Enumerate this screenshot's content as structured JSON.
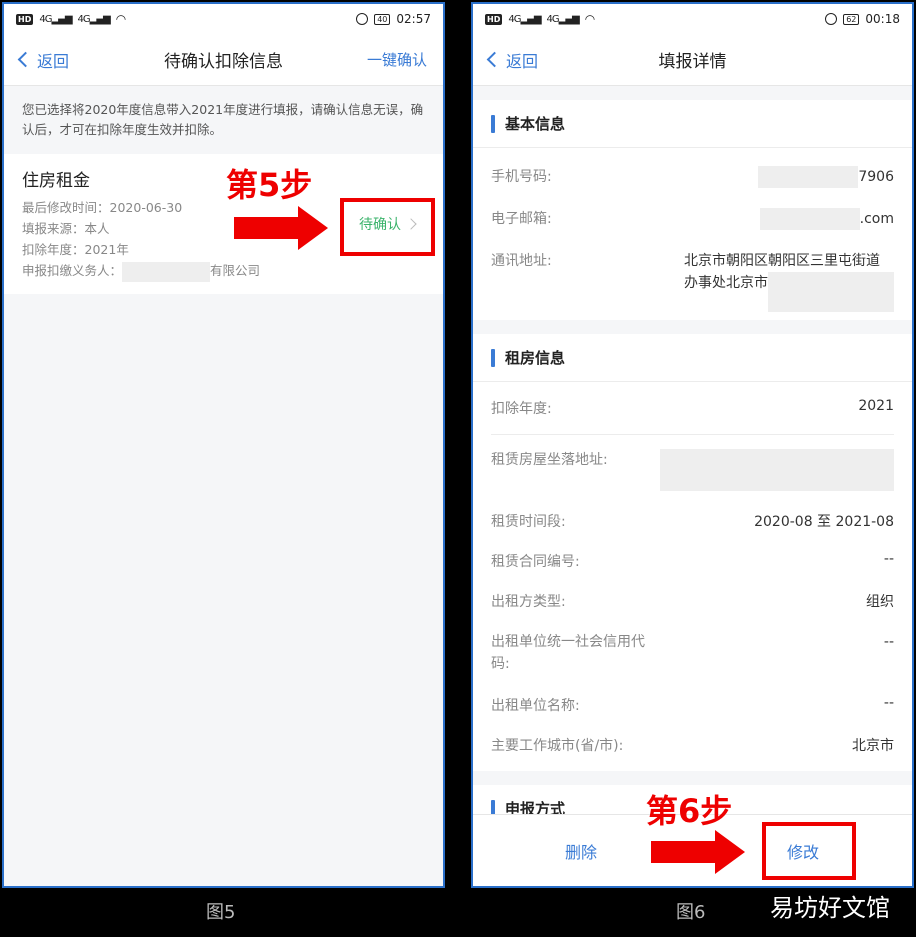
{
  "phone5": {
    "status": {
      "network": "HD",
      "signal1": "4G",
      "signal2": "4G",
      "battery": "40",
      "time": "02:57"
    },
    "nav": {
      "back": "返回",
      "title": "待确认扣除信息",
      "action": "一键确认"
    },
    "notice": "您已选择将2020年度信息带入2021年度进行填报，请确认信息无误，确认后，才可在扣除年度生效并扣除。",
    "card": {
      "title": "住房租金",
      "modified_label": "最后修改时间：",
      "modified_value": "2020-06-30",
      "source_label": "填报来源：",
      "source_value": "本人",
      "year_label": "扣除年度：",
      "year_value": "2021年",
      "agent_label": "申报扣缴义务人：",
      "agent_suffix": "有限公司",
      "status": "待确认"
    },
    "step": "第5步",
    "caption": "图5"
  },
  "phone6": {
    "status": {
      "network": "HD",
      "signal1": "4G",
      "signal2": "4G",
      "battery": "62",
      "time": "00:18"
    },
    "nav": {
      "back": "返回",
      "title": "填报详情"
    },
    "basic": {
      "title": "基本信息",
      "phone_label": "手机号码:",
      "phone_suffix": "7906",
      "email_label": "电子邮箱:",
      "email_suffix": ".com",
      "addr_label": "通讯地址:",
      "addr_line1": "北京市朝阳区朝阳区三里屯街道",
      "addr_line2": "办事处北京市"
    },
    "rent": {
      "title": "租房信息",
      "year_label": "扣除年度:",
      "year_value": "2021",
      "location_label": "租赁房屋坐落地址:",
      "period_label": "租赁时间段:",
      "period_value": "2020-08 至 2021-08",
      "contract_label": "租赁合同编号:",
      "contract_value": "--",
      "lessor_type_label": "出租方类型:",
      "lessor_type_value": "组织",
      "credit_label1": "出租单位统一社会信用代",
      "credit_label2": "码:",
      "credit_value": "--",
      "lessor_name_label": "出租单位名称:",
      "lessor_name_value": "--",
      "city_label": "主要工作城市(省/市):",
      "city_value": "北京市"
    },
    "declare": {
      "title": "申报方式"
    },
    "buttons": {
      "delete": "删除",
      "modify": "修改"
    },
    "step": "第6步",
    "caption": "图6"
  },
  "watermark": "易坊好文馆",
  "colors": {
    "accent": "#3a7bd5",
    "pending": "#3bb36b",
    "highlight": "#e00000"
  }
}
